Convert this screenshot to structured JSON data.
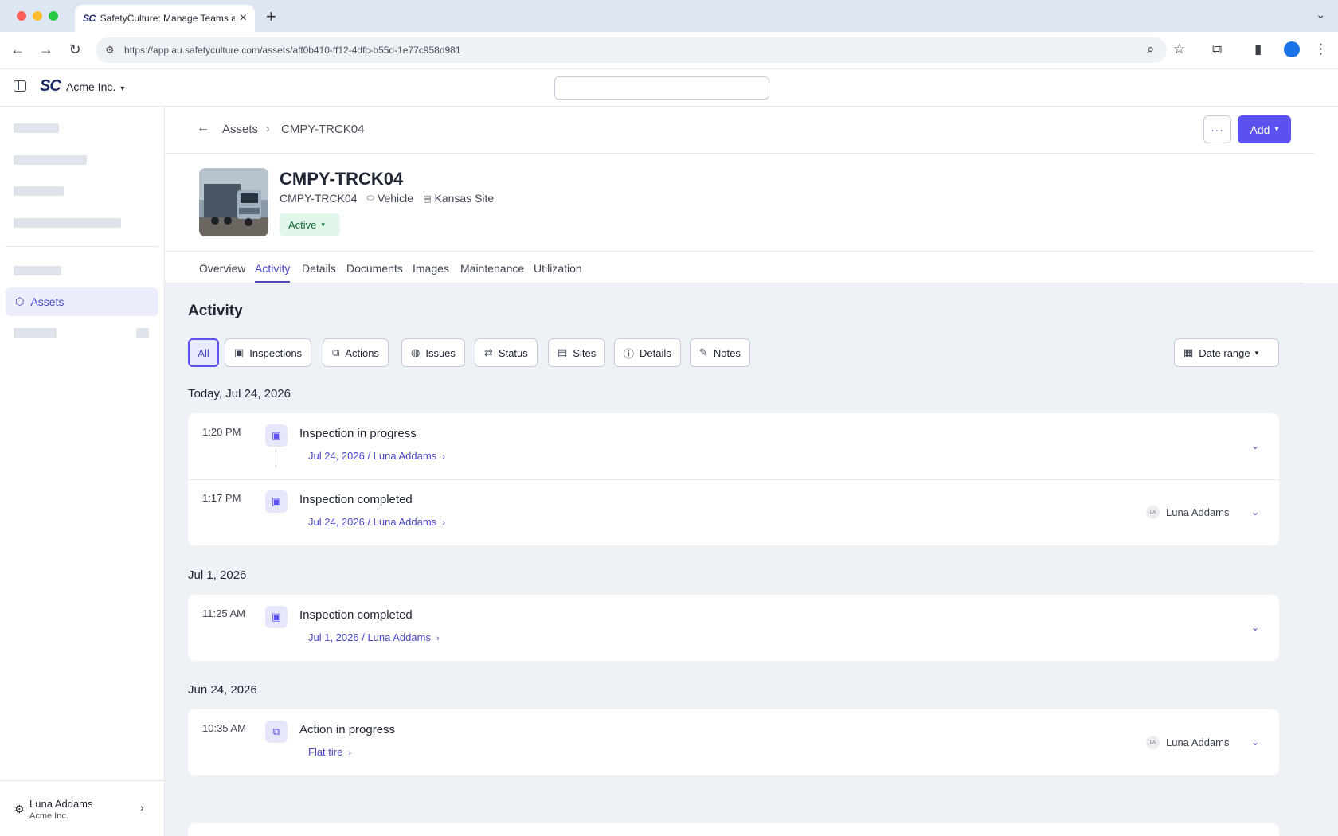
{
  "browser": {
    "tab_title": "SafetyCulture: Manage Teams and...",
    "tab_favicon": "SC",
    "url": "https://app.au.safetyculture.com/assets/aff0b410-ff12-4dfc-b55d-1e77c958d981"
  },
  "header": {
    "logo": "SC",
    "org_name": "Acme Inc."
  },
  "sidebar": {
    "active_item": "Assets",
    "user_name": "Luna Addams",
    "user_org": "Acme Inc."
  },
  "breadcrumb": {
    "parent": "Assets",
    "current": "CMPY-TRCK04"
  },
  "toolbar": {
    "more_label": "···",
    "add_label": "Add"
  },
  "asset": {
    "title": "CMPY-TRCK04",
    "code": "CMPY-TRCK04",
    "type": "Vehicle",
    "site": "Kansas Site",
    "status": "Active"
  },
  "tabs": [
    "Overview",
    "Activity",
    "Details",
    "Documents",
    "Images",
    "Maintenance",
    "Utilization"
  ],
  "activity": {
    "title": "Activity",
    "filters": [
      "All",
      "Inspections",
      "Actions",
      "Issues",
      "Status",
      "Sites",
      "Details",
      "Notes"
    ],
    "date_range_label": "Date range",
    "groups": [
      {
        "date": "Today, Jul 24, 2026",
        "items": [
          {
            "time": "1:20 PM",
            "title": "Inspection in progress",
            "link": "Jul 24, 2026 / Luna Addams",
            "user": ""
          },
          {
            "time": "1:17 PM",
            "title": "Inspection completed",
            "link": "Jul 24, 2026 / Luna Addams",
            "user": "Luna Addams",
            "user_initials": "LA"
          }
        ]
      },
      {
        "date": "Jul 1, 2026",
        "items": [
          {
            "time": "11:25 AM",
            "title": "Inspection completed",
            "link": "Jul 1, 2026 / Luna Addams",
            "user": ""
          }
        ]
      },
      {
        "date": "Jun 24, 2026",
        "items": [
          {
            "time": "10:35 AM",
            "title": "Action in progress",
            "link": "Flat tire",
            "user": "Luna Addams",
            "user_initials": "LA"
          }
        ]
      }
    ]
  },
  "colors": {
    "accent": "#5b50f0",
    "active_status_bg": "#e2f6ea",
    "active_status_text": "#0f6b3a",
    "content_bg": "#eef1f6"
  }
}
